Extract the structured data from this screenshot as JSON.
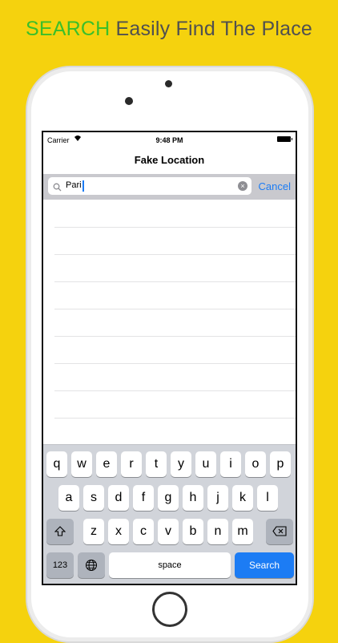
{
  "headline": {
    "accent": "SEARCH",
    "rest": "Easily Find The Place"
  },
  "status_bar": {
    "carrier": "Carrier",
    "time": "9:48 PM"
  },
  "navbar": {
    "title": "Fake Location"
  },
  "search": {
    "value": "Pari",
    "cancel_label": "Cancel"
  },
  "keyboard": {
    "row1": [
      "q",
      "w",
      "e",
      "r",
      "t",
      "y",
      "u",
      "i",
      "o",
      "p"
    ],
    "row2": [
      "a",
      "s",
      "d",
      "f",
      "g",
      "h",
      "j",
      "k",
      "l"
    ],
    "row3": [
      "z",
      "x",
      "c",
      "v",
      "b",
      "n",
      "m"
    ],
    "numbers_label": "123",
    "space_label": "space",
    "search_label": "Search"
  },
  "colors": {
    "background": "#f5d20e",
    "accent": "#3bbf2a",
    "link": "#1c7cf4"
  }
}
